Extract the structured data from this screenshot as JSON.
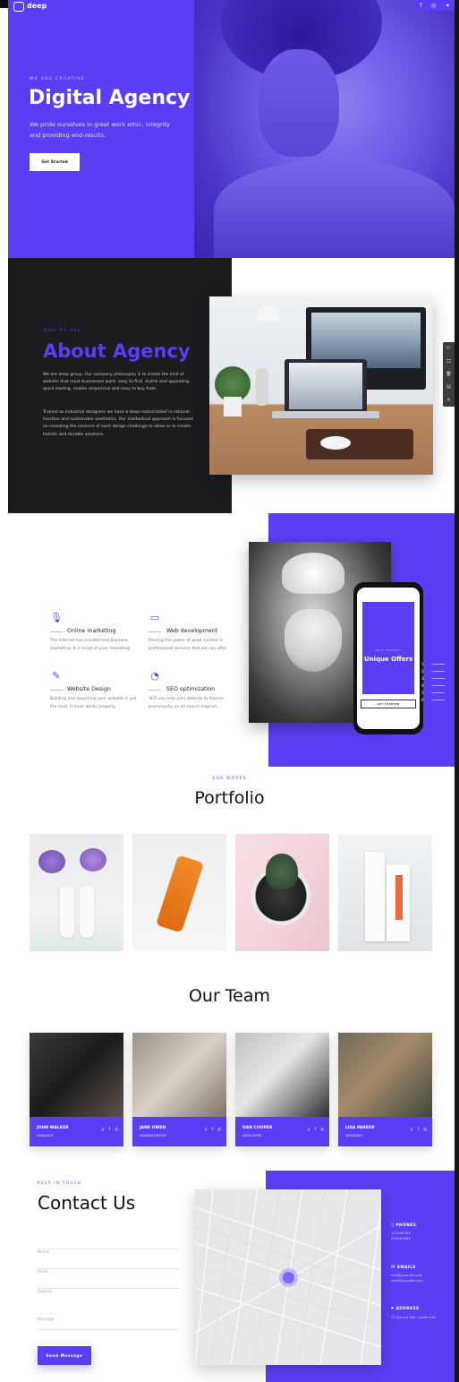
{
  "brand": {
    "name": "deep",
    "sub": "deep"
  },
  "hero": {
    "kicker": "WE ARE CREATIVE",
    "title": "Digital Agency",
    "text": "We pride ourselves in great work ethic, integrity and providing end-results.",
    "button": "Get Started",
    "social": [
      "f",
      "◎",
      "✦"
    ]
  },
  "about": {
    "kicker": "WHO WE ARE",
    "title": "About Agency",
    "p1": "We are deep group. Our company philosophy is to create the kind of website that most businesses want: easy to find, stylish and appealing, quick loading, mobile responsive and easy to buy from.",
    "p2": "Trained as industrial designers we have a deep-rooted belief in rational function and sustainable aesthetics. Our methodical approach is focused on revealing the essence of each design challenge to allow us to create holistic and durable solutions.",
    "tools": [
      "🛒",
      "🖵",
      "🗑",
      "▤",
      "⚲"
    ]
  },
  "services": {
    "items": [
      {
        "icon": "🎙",
        "title": "Online marketing",
        "desc": "The internet has transformed business marketing. It is heart of your marketing."
      },
      {
        "icon": "▭",
        "title": "Web development",
        "desc": "Proving the power of good content is professional services that we can offer."
      },
      {
        "icon": "✎",
        "title": "Website Design",
        "desc": "Building and launching your website is just the start. It must works properly."
      },
      {
        "icon": "◔",
        "title": "SEO optimization",
        "desc": "SEO can help your website to feature prominently on all search engines."
      }
    ],
    "phone": {
      "label": "BEST FEATURES",
      "title": "Unique Offers",
      "button": "GET STARTED"
    },
    "nav": [
      "1",
      "2",
      "3",
      "4",
      "5",
      "6"
    ]
  },
  "portfolio": {
    "kicker": "OUR WORKS",
    "title": "Portfolio"
  },
  "team": {
    "title": "Our Team",
    "members": [
      {
        "name": "JOHN WALKER",
        "role": "MANAGER"
      },
      {
        "name": "JANE OWEN",
        "role": "ADMINISTRATOR"
      },
      {
        "name": "DAN COOPER",
        "role": "DEVELOPER"
      },
      {
        "name": "LISA PARKER",
        "role": "DESIGNER"
      }
    ],
    "social": [
      "y",
      "f",
      "◎"
    ]
  },
  "contact": {
    "kicker": "KEEP IN TOUCH",
    "title": "Contact Us",
    "fields": [
      "Name",
      "Email",
      "Subject",
      "Message"
    ],
    "button": "Send Message",
    "phones": {
      "head": "PHONES",
      "l1": "123456789",
      "l2": "234567891"
    },
    "emails": {
      "head": "EMAILS",
      "l1": "info@youcafe.com",
      "l2": "sale@youcafe.com"
    },
    "address": {
      "head": "ADDRESS",
      "l1": "15 Spruce Ave, Lorem City"
    }
  },
  "colors": {
    "accent": "#5b3df5",
    "dark": "#1c1c1e"
  }
}
